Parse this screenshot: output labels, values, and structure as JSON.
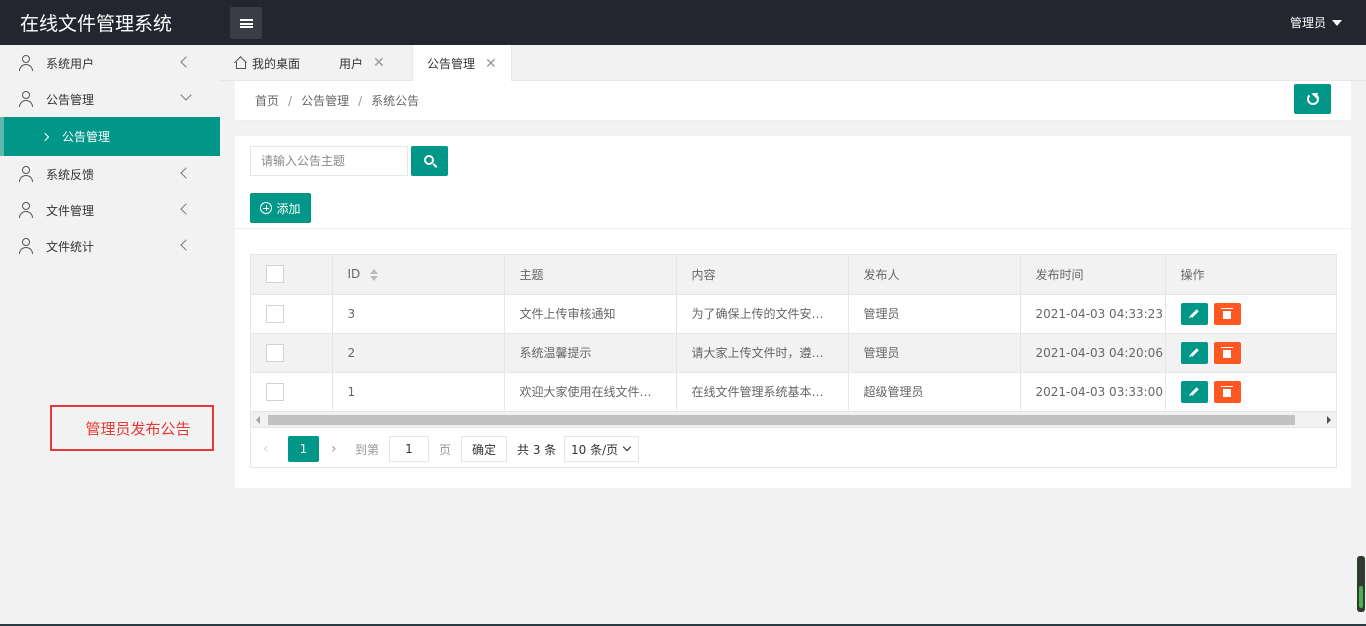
{
  "app": {
    "title": "在线文件管理系统",
    "user": "管理员"
  },
  "sidebar": {
    "items": [
      {
        "label": "系统用户"
      },
      {
        "label": "公告管理"
      },
      {
        "label": "公告管理"
      },
      {
        "label": "系统反馈"
      },
      {
        "label": "文件管理"
      },
      {
        "label": "文件统计"
      }
    ]
  },
  "tabs": [
    {
      "label": "我的桌面"
    },
    {
      "label": "用户"
    },
    {
      "label": "公告管理"
    }
  ],
  "breadcrumb": {
    "home": "首页",
    "section": "公告管理",
    "current": "系统公告"
  },
  "search": {
    "placeholder": "请输入公告主题"
  },
  "toolbar": {
    "add_label": "添加"
  },
  "table": {
    "headers": [
      "ID",
      "主题",
      "内容",
      "发布人",
      "发布时间",
      "操作"
    ],
    "rows": [
      {
        "id": "3",
        "subject": "文件上传审核通知",
        "content": "为了确保上传的文件安…",
        "publisher": "管理员",
        "time": "2021-04-03 04:33:23"
      },
      {
        "id": "2",
        "subject": "系统温馨提示",
        "content": "请大家上传文件时，遵…",
        "publisher": "管理员",
        "time": "2021-04-03 04:20:06"
      },
      {
        "id": "1",
        "subject": "欢迎大家使用在线文件…",
        "content": "在线文件管理系统基本…",
        "publisher": "超级管理员",
        "time": "2021-04-03 03:33:00"
      }
    ]
  },
  "pagination": {
    "current": "1",
    "goto_label": "到第",
    "input_value": "1",
    "page_unit": "页",
    "confirm": "确定",
    "total": "共 3 条",
    "page_size": "10 条/页"
  },
  "annotation": "管理员发布公告",
  "colors": {
    "primary": "#009688",
    "danger": "#ff5722",
    "header_bg": "#23262e",
    "annotation": "#e53935"
  }
}
